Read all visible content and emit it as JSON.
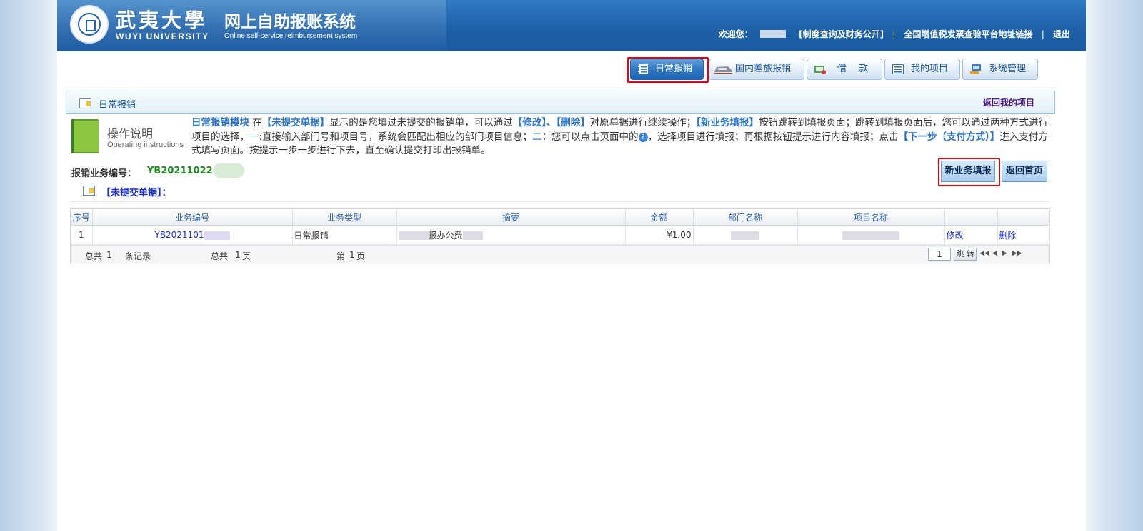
{
  "header": {
    "university_cn": "武夷大學",
    "university_en": "WUYI UNIVERSITY",
    "system_cn": "网上自助报账系统",
    "system_en": "Online self-service reimbursement system",
    "welcome": "欢迎您：",
    "links": [
      "[制度查询及财务公开]",
      "全国增值税发票查验平台地址链接",
      "退出"
    ],
    "separator": "|"
  },
  "tabs": [
    {
      "label": "日常报销",
      "icon": "notebook-icon",
      "active": true
    },
    {
      "label": "国内差旅报销",
      "icon": "train-icon",
      "active": false
    },
    {
      "label": "借　 款",
      "icon": "cash-icon",
      "active": false
    },
    {
      "label": "我的项目",
      "icon": "list-icon",
      "active": false
    },
    {
      "label": "系统管理",
      "icon": "computer-icon",
      "active": false
    }
  ],
  "titlebar": {
    "title": "日常报销",
    "return_link": "返回我的项目"
  },
  "instructions": {
    "title": "操作说明",
    "subtitle": "Operating instructions",
    "p1": "日常报销模块",
    "p2": " 在",
    "p3": "【未提交单据】",
    "p4": "显示的是您填过未提交的报销单，可以通过",
    "p5": "【修改】、【删除】",
    "p6": "对原单据进行继续操作；",
    "p7": "【新业务填报】",
    "p8": "按钮跳转到填报页面；跳转到填报页面后，您可以通过两种方式进行项目的选择，",
    "p9": "一",
    "p10": ":直接输入部门号和项目号，系统会匹配出相应的部门项目信息；",
    "p11": "二",
    "p12": "：您可以点击页面中的",
    "p13": "，选择项目进行填报；再根据按钮提示进行内容填报；点击",
    "p14": "【下一步（支付方式）】",
    "p15": "进入支付方式填写页面。按提示一步一步进行下去，直至确认提交打印出报销单。",
    "help_glyph": "?"
  },
  "business_no": {
    "label": "报销业务编号：",
    "value": "YB20211022"
  },
  "actions": {
    "new": "新业务填报",
    "home": "返回首页"
  },
  "section": {
    "title": "【未提交单据】："
  },
  "table": {
    "columns": [
      "序号",
      "业务编号",
      "业务类型",
      "摘要",
      "金额",
      "部门名称",
      "项目名称",
      "",
      ""
    ],
    "rows": [
      {
        "seq": "1",
        "biz_no": "YB2021101",
        "type": "日常报销",
        "summary": "报办公费",
        "amount": "¥1.00",
        "dept": "",
        "project": "",
        "edit": "修改",
        "delete": "删除"
      }
    ]
  },
  "pager": {
    "total_label": "总共",
    "total_records": "1",
    "records_suffix": "条记录",
    "pages_label": "总共",
    "pages": "1",
    "pages_suffix": "页",
    "current_label": "第",
    "current": "1",
    "current_suffix": "页",
    "page_input": "1",
    "go": "跳 转"
  },
  "colors": {
    "header_blue": "#1f62aa",
    "link_blue": "#1a2fd0",
    "highlight_red": "#e60012",
    "green_no": "#1a8a1a"
  }
}
